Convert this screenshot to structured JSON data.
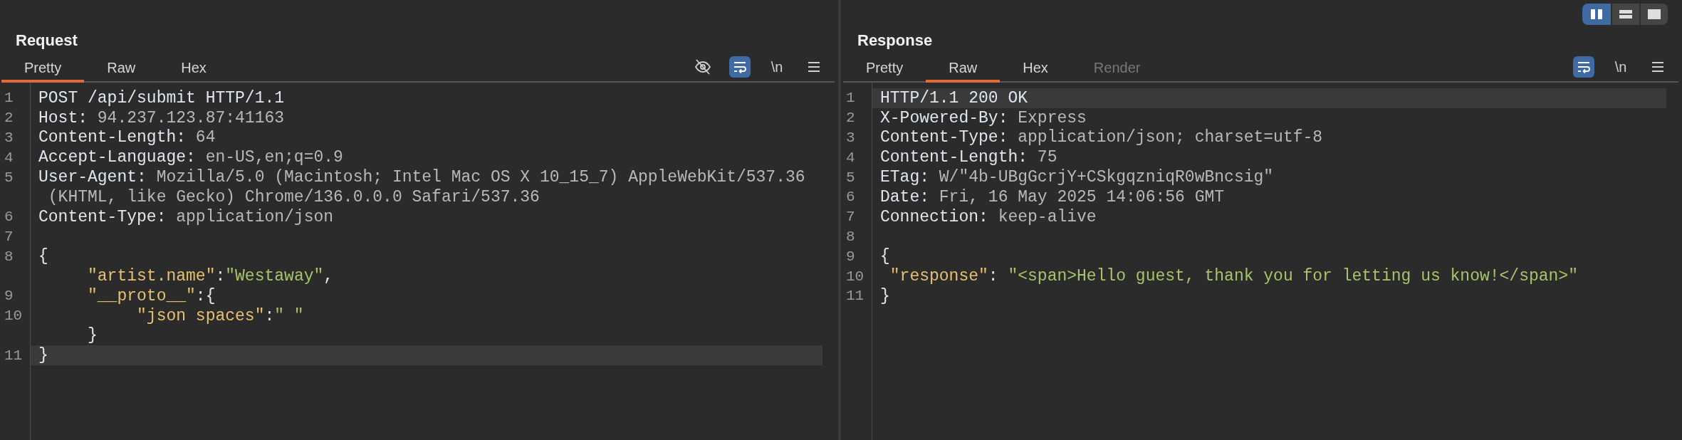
{
  "view_modes": [
    {
      "kind": "columns",
      "selected": true
    },
    {
      "kind": "rows",
      "selected": false
    },
    {
      "kind": "single",
      "selected": false
    }
  ],
  "panels": [
    {
      "title": "Request",
      "tabs": [
        {
          "label": "Pretty",
          "selected": true,
          "disabled": false
        },
        {
          "label": "Raw",
          "selected": false,
          "disabled": false
        },
        {
          "label": "Hex",
          "selected": false,
          "disabled": false
        }
      ],
      "tools": [
        {
          "kind": "hide"
        },
        {
          "kind": "wrap",
          "on": true
        },
        {
          "kind": "newline",
          "label": "\\n"
        },
        {
          "kind": "menu"
        }
      ],
      "lines": [
        {
          "number": "1",
          "segments": [
            {
              "kind": "name",
              "text": "POST /api/submit HTTP/1.1"
            }
          ]
        },
        {
          "number": "2",
          "segments": [
            {
              "kind": "name",
              "text": "Host:"
            },
            {
              "kind": "value",
              "text": " 94.237.123.87:41163"
            }
          ]
        },
        {
          "number": "3",
          "segments": [
            {
              "kind": "name",
              "text": "Content-Length:"
            },
            {
              "kind": "value",
              "text": " 64"
            }
          ]
        },
        {
          "number": "4",
          "segments": [
            {
              "kind": "name",
              "text": "Accept-Language:"
            },
            {
              "kind": "value",
              "text": " en-US,en;q=0.9"
            }
          ]
        },
        {
          "number": "5",
          "segments": [
            {
              "kind": "name",
              "text": "User-Agent:"
            },
            {
              "kind": "value",
              "text": " Mozilla/5.0 (Macintosh; Intel Mac OS X 10_15_7) AppleWebKit/537.36"
            }
          ]
        },
        {
          "segments": [
            {
              "kind": "value",
              "text": " (KHTML, like Gecko) Chrome/136.0.0.0 Safari/537.36"
            }
          ]
        },
        {
          "number": "6",
          "segments": [
            {
              "kind": "name",
              "text": "Content-Type:"
            },
            {
              "kind": "value",
              "text": " application/json"
            }
          ]
        },
        {
          "number": "7"
        },
        {
          "number": "8",
          "segments": [
            {
              "kind": "plain",
              "text": "{"
            }
          ]
        },
        {
          "segments": [
            {
              "kind": "key",
              "text": "     \"artist.name\""
            },
            {
              "kind": "plain",
              "text": ":"
            },
            {
              "kind": "string",
              "text": "\"Westaway\""
            },
            {
              "kind": "plain",
              "text": ","
            }
          ]
        },
        {
          "number": "9",
          "segments": [
            {
              "kind": "key",
              "text": "     \"__proto__\""
            },
            {
              "kind": "plain",
              "text": ":{"
            }
          ]
        },
        {
          "number": "10",
          "segments": [
            {
              "kind": "key",
              "text": "          \"json spaces\""
            },
            {
              "kind": "plain",
              "text": ":"
            },
            {
              "kind": "string",
              "text": "\" \""
            }
          ]
        },
        {
          "segments": [
            {
              "kind": "plain",
              "text": "     }"
            }
          ]
        },
        {
          "number": "11",
          "current": true,
          "segments": [
            {
              "kind": "plain",
              "text": "}"
            }
          ]
        }
      ]
    },
    {
      "title": "Response",
      "tabs": [
        {
          "label": "Pretty",
          "selected": false,
          "disabled": false
        },
        {
          "label": "Raw",
          "selected": true,
          "disabled": false
        },
        {
          "label": "Hex",
          "selected": false,
          "disabled": false
        },
        {
          "label": "Render",
          "selected": false,
          "disabled": true
        }
      ],
      "tools": [
        {
          "kind": "wrap",
          "on": true
        },
        {
          "kind": "newline",
          "label": "\\n"
        },
        {
          "kind": "menu"
        }
      ],
      "lines": [
        {
          "number": "1",
          "current": true,
          "segments": [
            {
              "kind": "name",
              "text": "HTTP/1.1 200 OK"
            }
          ]
        },
        {
          "number": "2",
          "segments": [
            {
              "kind": "name",
              "text": "X-Powered-By:"
            },
            {
              "kind": "value",
              "text": " Express"
            }
          ]
        },
        {
          "number": "3",
          "segments": [
            {
              "kind": "name",
              "text": "Content-Type:"
            },
            {
              "kind": "value",
              "text": " application/json; charset=utf-8"
            }
          ]
        },
        {
          "number": "4",
          "segments": [
            {
              "kind": "name",
              "text": "Content-Length:"
            },
            {
              "kind": "value",
              "text": " 75"
            }
          ]
        },
        {
          "number": "5",
          "segments": [
            {
              "kind": "name",
              "text": "ETag:"
            },
            {
              "kind": "value",
              "text": " W/\"4b-UBgGcrjY+CSkgqzniqR0wBncsig\""
            }
          ]
        },
        {
          "number": "6",
          "segments": [
            {
              "kind": "name",
              "text": "Date:"
            },
            {
              "kind": "value",
              "text": " Fri, 16 May 2025 14:06:56 GMT"
            }
          ]
        },
        {
          "number": "7",
          "segments": [
            {
              "kind": "name",
              "text": "Connection:"
            },
            {
              "kind": "value",
              "text": " keep-alive"
            }
          ]
        },
        {
          "number": "8"
        },
        {
          "number": "9",
          "segments": [
            {
              "kind": "plain",
              "text": "{"
            }
          ]
        },
        {
          "number": "10",
          "segments": [
            {
              "kind": "key",
              "text": " \"response\""
            },
            {
              "kind": "plain",
              "text": ": "
            },
            {
              "kind": "string",
              "text": "\"<span>Hello guest, thank you for letting us know!</span>\""
            }
          ]
        },
        {
          "number": "11",
          "segments": [
            {
              "kind": "plain",
              "text": "}"
            }
          ]
        }
      ]
    }
  ]
}
